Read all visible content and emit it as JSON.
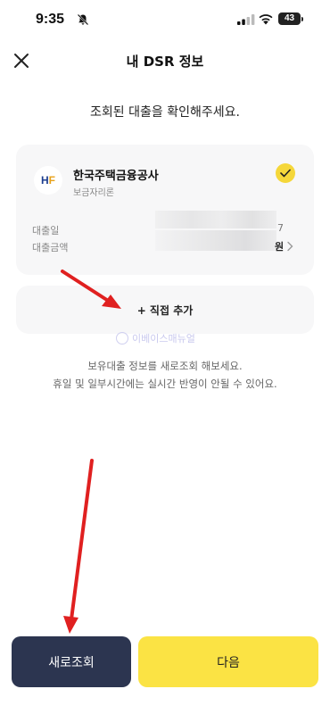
{
  "status_bar": {
    "time": "9:35",
    "battery": "43"
  },
  "header": {
    "title": "내 DSR 정보",
    "close_icon": "close-icon"
  },
  "subtitle": "조회된 대출을 확인해주세요.",
  "loan_card": {
    "logo_text_h": "H",
    "logo_text_f": "F",
    "lender": "한국주택금융공사",
    "product": "보금자리론",
    "selected": true,
    "rows": [
      {
        "label": "대출일",
        "value_tail": "7"
      },
      {
        "label": "대출금액",
        "value_tail": "원"
      }
    ]
  },
  "add_direct_label": "+ 직접 추가",
  "watermark": "이베이스매뉴얼",
  "info_lines": [
    "보유대출 정보를 새로조회 해보세요.",
    "휴일 및 일부시간에는 실시간 반영이 안될 수 있어요."
  ],
  "buttons": {
    "refresh": "새로조회",
    "next": "다음"
  },
  "colors": {
    "accent_yellow": "#fbe344",
    "dark_button": "#2c3550",
    "annotation_red": "#e02020"
  }
}
